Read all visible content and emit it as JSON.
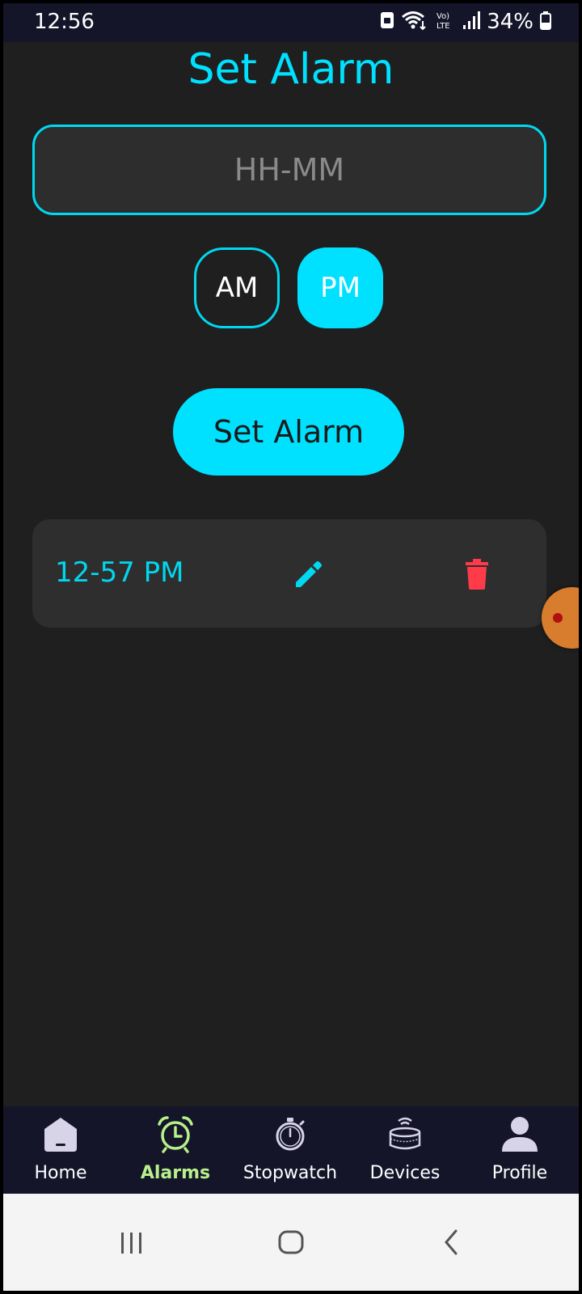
{
  "status_bar": {
    "time": "12:56",
    "battery": "34%",
    "icons": [
      "lock-sim-icon",
      "wifi-icon",
      "volte-icon",
      "signal-icon",
      "battery-icon"
    ]
  },
  "page": {
    "title": "Set Alarm"
  },
  "time_input": {
    "placeholder": "HH-MM",
    "value": ""
  },
  "period": {
    "am_label": "AM",
    "pm_label": "PM",
    "selected": "PM"
  },
  "set_button": {
    "label": "Set Alarm"
  },
  "alarms": [
    {
      "time": "12-57 PM",
      "edit_icon": "pencil-icon",
      "delete_icon": "trash-icon"
    }
  ],
  "bottom_nav": {
    "active": "Alarms",
    "items": [
      {
        "label": "Home",
        "icon": "home-icon"
      },
      {
        "label": "Alarms",
        "icon": "alarm-clock-icon"
      },
      {
        "label": "Stopwatch",
        "icon": "stopwatch-icon"
      },
      {
        "label": "Devices",
        "icon": "smart-speaker-icon"
      },
      {
        "label": "Profile",
        "icon": "person-icon"
      }
    ]
  },
  "system_nav": {
    "icons": [
      "recents-icon",
      "home-circle-icon",
      "back-icon"
    ]
  },
  "colors": {
    "accent": "#00e0ff",
    "background": "#1f1f1f",
    "card": "#2e2e2e",
    "nav_background": "#15152a",
    "active_nav": "#b8f08a",
    "delete": "#ff3b4a"
  }
}
